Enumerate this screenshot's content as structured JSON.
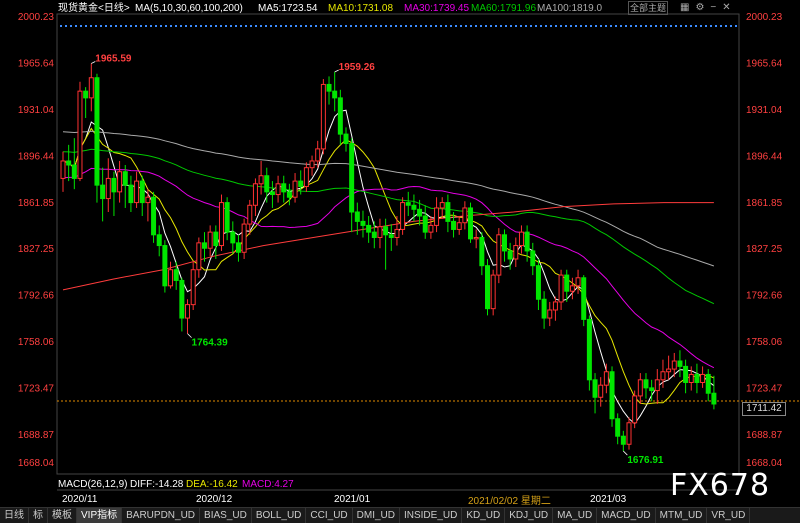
{
  "header": {
    "symbol": "现货黄金",
    "period": "<日线>",
    "ma_params": "MA(5,10,30,60,100,200)",
    "ma5": "MA5:1723.54",
    "ma10": "MA10:1731.08",
    "ma30": "MA30:1739.45",
    "ma60": "MA60:1791.96",
    "ma100": "MA100:1819.0",
    "theme_button": "全部主题",
    "icons": [
      "grid-icon",
      "settings-icon",
      "minus-icon",
      "close-icon"
    ]
  },
  "macd": {
    "label": "MACD(26,12,9)",
    "diff": "DIFF:-14.28",
    "dea": "DEA:-16.42",
    "macd": "MACD:4.27"
  },
  "last_price": "1711.42",
  "cursor_date": "2021/02/02 星期二",
  "watermark": "FX678",
  "toolbar": [
    "日线",
    "标",
    "模板",
    "VIP指标",
    "BARUPDN_UD",
    "BIAS_UD",
    "BOLL_UD",
    "CCI_UD",
    "DMI_UD",
    "INSIDE_UD",
    "KD_UD",
    "KDJ_UD",
    "MA_UD",
    "MACD_UD",
    "MTM_UD",
    "VR_UD"
  ],
  "colors": {
    "up": "#ff3232",
    "down": "#00e600",
    "ma5": "#ffffff",
    "ma10": "#e6e600",
    "ma30": "#e600e6",
    "ma60": "#00c800",
    "ma100": "#aaaaaa",
    "ma200": "#ff3c3c",
    "grid_label": "#ff4040"
  },
  "chart_data": {
    "type": "candlestick",
    "title": "现货黄金 <日线>",
    "y_ticks": [
      "2000.23",
      "1965.64",
      "1931.04",
      "1896.44",
      "1861.85",
      "1827.25",
      "1792.66",
      "1758.06",
      "1723.47",
      "1688.87",
      "1668.04"
    ],
    "x_ticks": [
      "2020/11",
      "2020/12",
      "2021/01",
      "2021/03"
    ],
    "ylim": [
      1668.04,
      2000.23
    ],
    "annotations": [
      {
        "label": "1965.59",
        "value": 1965.59
      },
      {
        "label": "1764.39",
        "value": 1764.39
      },
      {
        "label": "1959.26",
        "value": 1959.26
      },
      {
        "label": "1676.91",
        "value": 1676.91
      }
    ],
    "candles": [
      [
        1880,
        1893,
        1870,
        1900
      ],
      [
        1893,
        1890,
        1878,
        1905
      ],
      [
        1890,
        1880,
        1872,
        1910
      ],
      [
        1880,
        1945,
        1878,
        1952
      ],
      [
        1945,
        1940,
        1925,
        1948
      ],
      [
        1940,
        1955,
        1930,
        1965.59
      ],
      [
        1955,
        1875,
        1862,
        1958
      ],
      [
        1875,
        1865,
        1848,
        1888
      ],
      [
        1865,
        1880,
        1855,
        1895
      ],
      [
        1880,
        1870,
        1852,
        1885
      ],
      [
        1870,
        1885,
        1862,
        1893
      ],
      [
        1885,
        1875,
        1858,
        1890
      ],
      [
        1875,
        1862,
        1855,
        1882
      ],
      [
        1862,
        1878,
        1858,
        1885
      ],
      [
        1878,
        1862,
        1852,
        1882
      ],
      [
        1862,
        1866,
        1848,
        1872
      ],
      [
        1866,
        1838,
        1832,
        1870
      ],
      [
        1838,
        1830,
        1822,
        1845
      ],
      [
        1830,
        1800,
        1795,
        1834
      ],
      [
        1800,
        1812,
        1798,
        1818
      ],
      [
        1812,
        1804,
        1797,
        1818
      ],
      [
        1804,
        1776,
        1766,
        1806
      ],
      [
        1776,
        1786,
        1764.39,
        1790
      ],
      [
        1786,
        1812,
        1782,
        1818
      ],
      [
        1812,
        1832,
        1806,
        1836
      ],
      [
        1832,
        1828,
        1818,
        1840
      ],
      [
        1828,
        1840,
        1822,
        1845
      ],
      [
        1840,
        1830,
        1820,
        1845
      ],
      [
        1830,
        1862,
        1826,
        1868
      ],
      [
        1862,
        1840,
        1834,
        1866
      ],
      [
        1840,
        1832,
        1824,
        1848
      ],
      [
        1832,
        1825,
        1818,
        1838
      ],
      [
        1825,
        1846,
        1820,
        1850
      ],
      [
        1846,
        1860,
        1838,
        1864
      ],
      [
        1860,
        1876,
        1852,
        1880
      ],
      [
        1876,
        1882,
        1868,
        1893
      ],
      [
        1882,
        1870,
        1862,
        1888
      ],
      [
        1870,
        1868,
        1858,
        1878
      ],
      [
        1868,
        1876,
        1862,
        1882
      ],
      [
        1876,
        1870,
        1862,
        1882
      ],
      [
        1870,
        1866,
        1860,
        1876
      ],
      [
        1866,
        1878,
        1862,
        1884
      ],
      [
        1878,
        1874,
        1868,
        1886
      ],
      [
        1874,
        1888,
        1870,
        1892
      ],
      [
        1888,
        1893,
        1882,
        1897
      ],
      [
        1893,
        1902,
        1888,
        1908
      ],
      [
        1902,
        1950,
        1898,
        1954
      ],
      [
        1950,
        1945,
        1935,
        1956
      ],
      [
        1945,
        1940,
        1930,
        1959.26
      ],
      [
        1940,
        1913,
        1905,
        1946
      ],
      [
        1913,
        1906,
        1900,
        1918
      ],
      [
        1906,
        1855,
        1840,
        1910
      ],
      [
        1855,
        1848,
        1838,
        1862
      ],
      [
        1848,
        1845,
        1836,
        1856
      ],
      [
        1845,
        1840,
        1832,
        1852
      ],
      [
        1840,
        1836,
        1828,
        1848
      ],
      [
        1836,
        1844,
        1828,
        1850
      ],
      [
        1844,
        1838,
        1812,
        1850
      ],
      [
        1838,
        1836,
        1826,
        1846
      ],
      [
        1836,
        1842,
        1830,
        1852
      ],
      [
        1842,
        1862,
        1838,
        1866
      ],
      [
        1862,
        1860,
        1852,
        1870
      ],
      [
        1860,
        1857,
        1848,
        1868
      ],
      [
        1857,
        1852,
        1845,
        1864
      ],
      [
        1852,
        1840,
        1835,
        1860
      ],
      [
        1840,
        1845,
        1835,
        1852
      ],
      [
        1845,
        1858,
        1840,
        1866
      ],
      [
        1858,
        1862,
        1850,
        1866
      ],
      [
        1862,
        1848,
        1840,
        1868
      ],
      [
        1848,
        1842,
        1836,
        1855
      ],
      [
        1842,
        1847,
        1838,
        1852
      ],
      [
        1847,
        1858,
        1842,
        1863
      ],
      [
        1858,
        1835,
        1832,
        1862
      ],
      [
        1835,
        1836,
        1828,
        1842
      ],
      [
        1836,
        1815,
        1808,
        1840
      ],
      [
        1815,
        1783,
        1778,
        1820
      ],
      [
        1783,
        1808,
        1778,
        1812
      ],
      [
        1808,
        1838,
        1802,
        1843
      ],
      [
        1838,
        1826,
        1818,
        1842
      ],
      [
        1826,
        1820,
        1812,
        1832
      ],
      [
        1820,
        1830,
        1814,
        1836
      ],
      [
        1830,
        1840,
        1824,
        1845
      ],
      [
        1840,
        1826,
        1818,
        1845
      ],
      [
        1826,
        1815,
        1808,
        1832
      ],
      [
        1815,
        1790,
        1782,
        1820
      ],
      [
        1790,
        1776,
        1768,
        1796
      ],
      [
        1776,
        1782,
        1770,
        1788
      ],
      [
        1782,
        1788,
        1774,
        1792
      ],
      [
        1788,
        1808,
        1782,
        1812
      ],
      [
        1808,
        1796,
        1788,
        1812
      ],
      [
        1796,
        1800,
        1790,
        1806
      ],
      [
        1800,
        1806,
        1794,
        1812
      ],
      [
        1806,
        1775,
        1770,
        1808
      ],
      [
        1775,
        1730,
        1722,
        1778
      ],
      [
        1730,
        1717,
        1705,
        1735
      ],
      [
        1717,
        1726,
        1710,
        1732
      ],
      [
        1726,
        1736,
        1720,
        1742
      ],
      [
        1736,
        1701,
        1695,
        1740
      ],
      [
        1701,
        1688,
        1682,
        1705
      ],
      [
        1688,
        1682,
        1676.91,
        1692
      ],
      [
        1682,
        1698,
        1678,
        1702
      ],
      [
        1698,
        1718,
        1694,
        1722
      ],
      [
        1718,
        1730,
        1712,
        1735
      ],
      [
        1730,
        1724,
        1716,
        1735
      ],
      [
        1724,
        1722,
        1714,
        1730
      ],
      [
        1722,
        1730,
        1712,
        1738
      ],
      [
        1730,
        1736,
        1724,
        1745
      ],
      [
        1736,
        1738,
        1730,
        1748
      ],
      [
        1738,
        1744,
        1732,
        1750
      ],
      [
        1744,
        1740,
        1732,
        1752
      ],
      [
        1740,
        1728,
        1720,
        1745
      ],
      [
        1728,
        1734,
        1722,
        1740
      ],
      [
        1734,
        1728,
        1720,
        1742
      ],
      [
        1728,
        1734,
        1724,
        1740
      ],
      [
        1734,
        1720,
        1714,
        1738
      ],
      [
        1720,
        1712,
        1708,
        1733
      ]
    ],
    "series": [
      {
        "name": "MA5",
        "values": []
      },
      {
        "name": "MA10",
        "values": []
      },
      {
        "name": "MA30",
        "values": []
      },
      {
        "name": "MA60",
        "values": []
      },
      {
        "name": "MA100",
        "values": []
      },
      {
        "name": "MA200",
        "values": [
          1797,
          1805,
          1812,
          1822,
          1830,
          1836,
          1842,
          1848,
          1852,
          1855,
          1859,
          1861,
          1862,
          1862
        ]
      }
    ],
    "grid": false,
    "legend": "top-left"
  }
}
